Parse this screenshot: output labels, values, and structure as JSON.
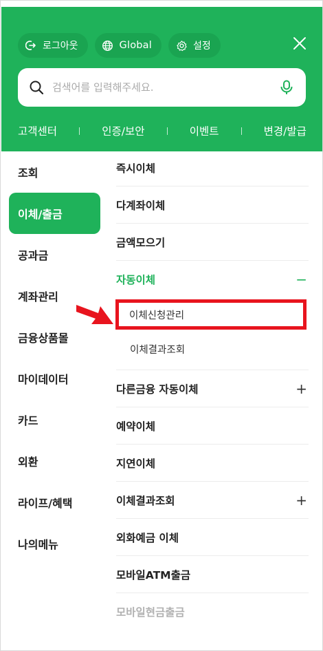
{
  "colors": {
    "brand_green": "#1fb25a",
    "highlight_red": "#e8141e"
  },
  "header": {
    "logout": {
      "icon": "logout-icon",
      "label": "로그아웃"
    },
    "global": {
      "icon": "globe-icon",
      "label": "Global"
    },
    "settings": {
      "icon": "gear-icon",
      "label": "설정"
    },
    "close_icon": "close-icon"
  },
  "search": {
    "placeholder": "검색어를 입력해주세요.",
    "value": ""
  },
  "quick_links": [
    "고객센터",
    "인증/보안",
    "이벤트",
    "변경/발급"
  ],
  "left_menu": [
    {
      "label": "조회",
      "active": false
    },
    {
      "label": "이체/출금",
      "active": true
    },
    {
      "label": "공과금",
      "active": false
    },
    {
      "label": "계좌관리",
      "active": false
    },
    {
      "label": "금융상품몰",
      "active": false
    },
    {
      "label": "마이데이터",
      "active": false
    },
    {
      "label": "카드",
      "active": false
    },
    {
      "label": "외환",
      "active": false
    },
    {
      "label": "라이프/혜택",
      "active": false
    },
    {
      "label": "나의메뉴",
      "active": false
    }
  ],
  "right_menu": {
    "items_top": [
      "즉시이체",
      "다계좌이체",
      "금액모으기"
    ],
    "expanded": {
      "label": "자동이체",
      "sign": "−",
      "children": [
        "이체신청관리",
        "이체결과조회"
      ]
    },
    "items_bottom": [
      {
        "label": "다른금융 자동이체",
        "sign": "+"
      },
      {
        "label": "예약이체",
        "sign": ""
      },
      {
        "label": "지연이체",
        "sign": ""
      },
      {
        "label": "이체결과조회",
        "sign": "+"
      },
      {
        "label": "외화예금 이체",
        "sign": ""
      },
      {
        "label": "모바일ATM출금",
        "sign": ""
      }
    ],
    "partial_item": "모바일현금출금"
  }
}
